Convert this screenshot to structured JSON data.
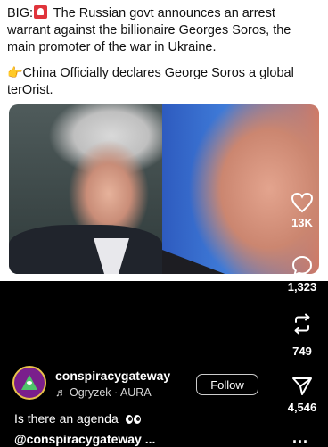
{
  "tweet": {
    "line1_prefix": "BIG:",
    "line1_rest": "The Russian govt announces an arrest warrant against the billionaire Georges Soros, the main promoter of the war in Ukraine.",
    "line2": "China Officially declares George Soros a global terOrist."
  },
  "actions": {
    "likes": "13K",
    "comments": "1,323",
    "reposts": "749",
    "shares": "4,546"
  },
  "user": {
    "username": "conspiracygateway",
    "music": "Ogryzek · AURA",
    "follow_label": "Follow"
  },
  "caption": {
    "text": "Is there an agenda",
    "handle": "@conspiracygateway ..."
  },
  "more_label": "..."
}
